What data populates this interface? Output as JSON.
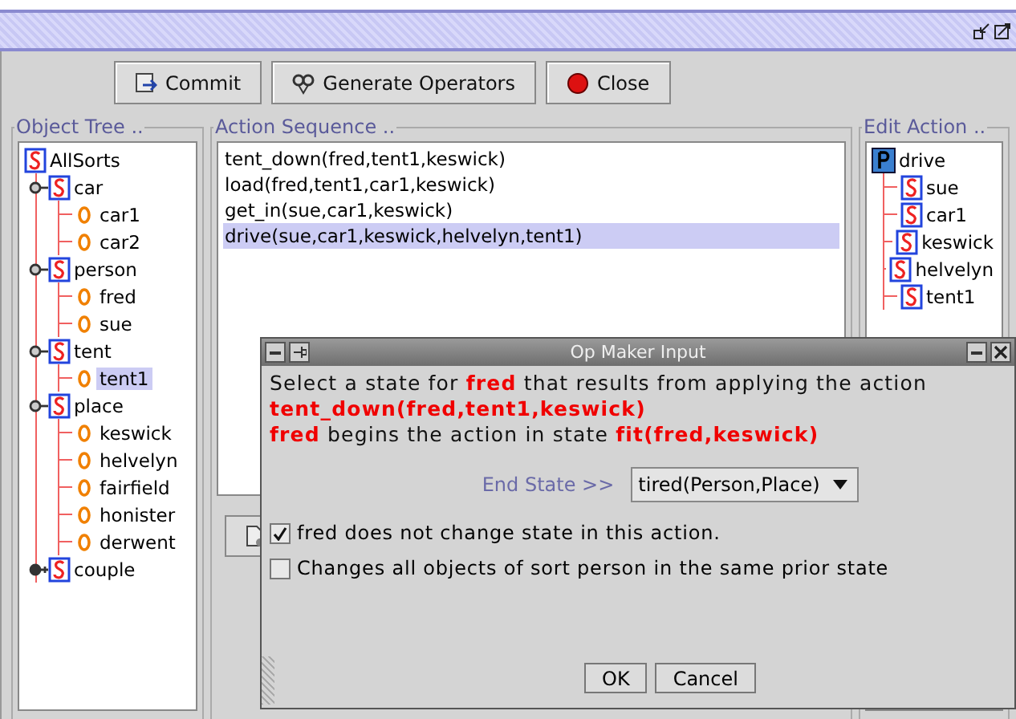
{
  "toolbar": {
    "buttons": [
      {
        "label": "Commit",
        "kind": "commit"
      },
      {
        "label": "Generate Operators",
        "kind": "generate"
      },
      {
        "label": "Close",
        "kind": "close"
      }
    ]
  },
  "object_tree": {
    "title": "Object Tree ..",
    "root": {
      "label": "AllSorts",
      "kind": "sort",
      "selected": false,
      "children": [
        {
          "label": "car",
          "kind": "sort",
          "selected": false,
          "expanded": true,
          "children": [
            {
              "label": "car1",
              "kind": "object",
              "selected": false
            },
            {
              "label": "car2",
              "kind": "object",
              "selected": false
            }
          ]
        },
        {
          "label": "person",
          "kind": "sort",
          "selected": false,
          "expanded": true,
          "children": [
            {
              "label": "fred",
              "kind": "object",
              "selected": false
            },
            {
              "label": "sue",
              "kind": "object",
              "selected": false
            }
          ]
        },
        {
          "label": "tent",
          "kind": "sort",
          "selected": false,
          "expanded": true,
          "children": [
            {
              "label": "tent1",
              "kind": "object",
              "selected": true
            }
          ]
        },
        {
          "label": "place",
          "kind": "sort",
          "selected": false,
          "expanded": true,
          "children": [
            {
              "label": "keswick",
              "kind": "object",
              "selected": false
            },
            {
              "label": "helvelyn",
              "kind": "object",
              "selected": false
            },
            {
              "label": "fairfield",
              "kind": "object",
              "selected": false
            },
            {
              "label": "honister",
              "kind": "object",
              "selected": false
            },
            {
              "label": "derwent",
              "kind": "object",
              "selected": false
            }
          ]
        },
        {
          "label": "couple",
          "kind": "sort",
          "selected": false,
          "expanded": false
        }
      ]
    }
  },
  "action_sequence": {
    "title": "Action Sequence ..",
    "items": [
      {
        "label": "tent_down(fred,tent1,keswick)",
        "selected": false
      },
      {
        "label": "load(fred,tent1,car1,keswick)",
        "selected": false
      },
      {
        "label": "get_in(sue,car1,keswick)",
        "selected": false
      },
      {
        "label": "drive(sue,car1,keswick,helvelyn,tent1)",
        "selected": true
      }
    ]
  },
  "edit_action": {
    "title": "Edit Action ..",
    "root": {
      "label": "drive",
      "kind": "predicate",
      "selected": false,
      "children": [
        {
          "label": "sue",
          "kind": "sort",
          "selected": false
        },
        {
          "label": "car1",
          "kind": "sort",
          "selected": false
        },
        {
          "label": "keswick",
          "kind": "sort",
          "selected": false
        },
        {
          "label": "helvelyn",
          "kind": "sort",
          "selected": false
        },
        {
          "label": "tent1",
          "kind": "sort",
          "selected": false
        }
      ]
    }
  },
  "dialog": {
    "title": "Op Maker Input",
    "message": "Select a state for **fred** that results from applying the action\n**tent_down(fred,tent1,keswick)**\n**fred** begins the action in state **fit(fred,keswick)**",
    "end_state": {
      "label": "End State >>",
      "value": "tired(Person,Place)"
    },
    "checkboxes": [
      {
        "label": "fred does not change state in this action.",
        "checked": true
      },
      {
        "label": "Changes all objects of sort person in the same prior state",
        "checked": false
      }
    ],
    "buttons": [
      "OK",
      "Cancel"
    ]
  }
}
